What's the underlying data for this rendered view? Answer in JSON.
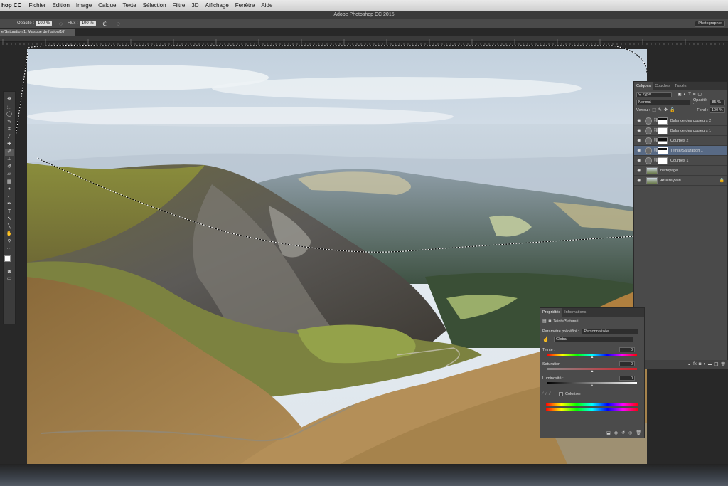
{
  "menubar": {
    "app": "hop CC",
    "items": [
      "Fichier",
      "Edition",
      "Image",
      "Calque",
      "Texte",
      "Sélection",
      "Filtre",
      "3D",
      "Affichage",
      "Fenêtre",
      "Aide"
    ]
  },
  "window_title": "Adobe Photoshop CC 2015",
  "options": {
    "opacity_label": "Opacité :",
    "opacity_value": "100 %",
    "flow_label": "Flux :",
    "flow_value": "100 %",
    "workspace": "Photographie"
  },
  "document_tab": "e/Saturation 1, Masque de fusion/16)",
  "layers_panel": {
    "tabs": [
      "Calques",
      "Couches",
      "Tracés"
    ],
    "filter": "Type",
    "blend_mode": "Normal",
    "opacity_label": "Opacité :",
    "opacity_value": "85 %",
    "lock_label": "Verrou :",
    "fill_label": "Fond :",
    "fill_value": "100 %",
    "layers": [
      {
        "name": "Balance des couleurs 2",
        "kind": "adjustment",
        "mask": "dark"
      },
      {
        "name": "Balance des couleurs 1",
        "kind": "adjustment",
        "mask": "white"
      },
      {
        "name": "Courbes 2",
        "kind": "adjustment",
        "mask": "dark"
      },
      {
        "name": "Teinte/Saturation 1",
        "kind": "adjustment",
        "mask": "dark",
        "selected": true
      },
      {
        "name": "Courbes 1",
        "kind": "adjustment",
        "mask": "white"
      },
      {
        "name": "nettoyage",
        "kind": "pixel"
      },
      {
        "name": "Arrière-plan",
        "kind": "background",
        "locked": true
      }
    ]
  },
  "properties_panel": {
    "tabs": [
      "Propriétés",
      "Informations"
    ],
    "header": "Teinte/Saturati...",
    "preset_label": "Paramètre prédéfini :",
    "preset_value": "Personnalisée",
    "channel": "Global",
    "hue_label": "Teinte :",
    "hue_value": "0",
    "saturation_label": "Saturation :",
    "saturation_value": "0",
    "lightness_label": "Luminosité :",
    "lightness_value": "0",
    "colorize_label": "Coloriser"
  },
  "colors": {
    "chrome": "#4a4a4a",
    "selected_layer": "#586a85",
    "menubar": "#dcdcdc"
  }
}
